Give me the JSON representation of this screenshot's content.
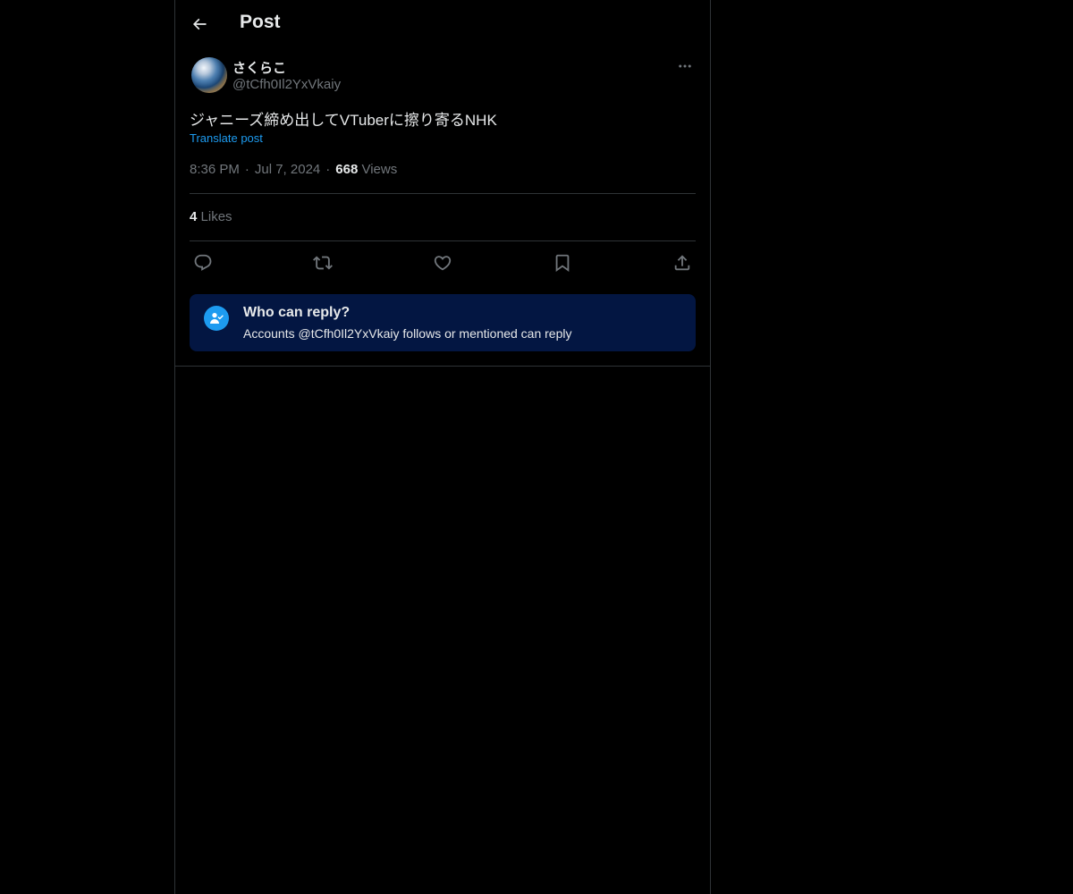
{
  "header": {
    "title": "Post",
    "back_icon": "arrow-left-icon"
  },
  "post": {
    "author": {
      "display_name": "さくらこ",
      "handle": "@tCfh0Il2YxVkaiy",
      "avatar": "earth-globe-avatar"
    },
    "text": "ジャニーズ締め出してVTuberに擦り寄るNHK",
    "translate_label": "Translate post",
    "time": "8:36 PM",
    "date": "Jul 7, 2024",
    "separator": "·",
    "views_count": "668",
    "views_label": "Views",
    "likes_count": "4",
    "likes_label": "Likes"
  },
  "actions": [
    {
      "name": "reply",
      "icon": "comment-icon"
    },
    {
      "name": "repost",
      "icon": "repost-icon"
    },
    {
      "name": "like",
      "icon": "heart-icon"
    },
    {
      "name": "bookmark",
      "icon": "bookmark-icon"
    },
    {
      "name": "share",
      "icon": "share-icon"
    }
  ],
  "reply_restriction": {
    "title": "Who can reply?",
    "subtitle": "Accounts @tCfh0Il2YxVkaiy follows or mentioned can reply",
    "icon": "person-check-icon"
  },
  "colors": {
    "background": "#000000",
    "text_primary": "#e7e9ea",
    "text_secondary": "#71767b",
    "accent": "#1d9bf0",
    "border": "#2f3336",
    "reply_box_bg": "#031642"
  }
}
